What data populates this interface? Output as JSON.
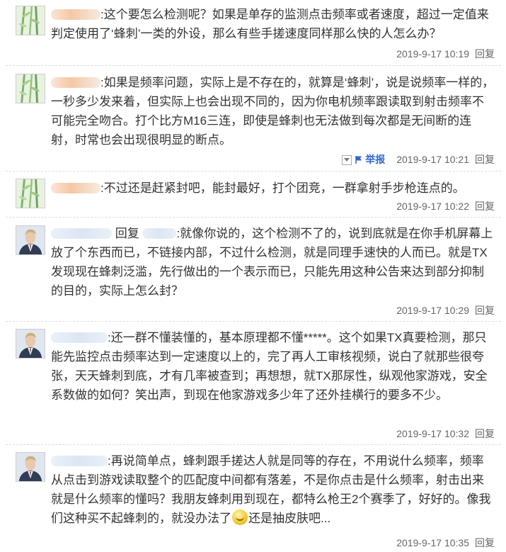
{
  "replies": [
    {
      "user_type": "bamboo",
      "text": ":这个要怎么检测呢？如果是单存的监测点击频率或者速度，超过一定值来判定使用了‘蜂刺’一类的外设，那么有些手搓速度同样那么快的人怎么办？",
      "time": "2019-9-17 10:19",
      "reply_label": "回复"
    },
    {
      "user_type": "bamboo",
      "text": ":如果是频率问题，实际上是不存在的，就算是‘蜂刺’，说是说频率一样的，一秒多少发来着，但实际上也会出现不同的，因为你电机频率跟读取到射击频率不可能完全吻合。打个比方M16三连，即使是蜂刺也无法做到每次都是无间断的连射，时常也会出现很明显的断点。",
      "report_label": "举报",
      "time": "2019-9-17 10:21",
      "reply_label": "回复"
    },
    {
      "user_type": "bamboo",
      "text": ":不过还是赶紧封吧，能封最好，打个团竞，一群拿射手步枪连点的。",
      "time": "2019-9-17 10:22",
      "reply_label": "回复"
    },
    {
      "user_type": "person",
      "reply_word": "回复",
      "text": ":就像你说的，这个检测不了的，说到底就是在你手机屏幕上放了个东西而已，不链接内部，不过什么检测，就是同理手速快的人而已。就是TX发现现在蜂刺泛滥，先行做出的一个表示而已，只能先用这种公告来达到部分抑制的目的，实际上怎么封？",
      "time": "2019-9-17 10:29",
      "reply_label": "回复"
    },
    {
      "user_type": "person",
      "text": ":还一群不懂装懂的，基本原理都不懂*****。这个如果TX真要检测，那只能先监控点击频率达到一定速度以上的，完了再人工审核视频，说白了就那些很夸张，天天蜂刺到底，才有几率被查到；再想想，就TX那尿性，纵观他家游戏，安全系数做的如何？笑出声，到现在他家游戏多少年了还外挂横行的要多不少。",
      "time": "2019-9-17 10:32",
      "reply_label": "回复"
    },
    {
      "user_type": "person",
      "text_before_emoji": ":再说简单点，蜂刺跟手搓达人就是同等的存在，不用说什么频率，频率从点击到游戏读取整个的匹配度中间都有落差，不是你点击是什么频率，射击出来就是什么频率的懂吗？我朋友蜂刺用到现在，都特么枪王2个赛季了，好好的。像我们这种买不起蜂刺的，就没办法了",
      "text_after_emoji": "还是抽皮肤吧...",
      "emoji_name": "smile-emoji",
      "time": "2019-9-17 10:35",
      "reply_label": "回复"
    }
  ],
  "colors": {
    "text": "#333333",
    "meta": "#666666",
    "link": "#3366cc",
    "divider": "#dddddd"
  }
}
